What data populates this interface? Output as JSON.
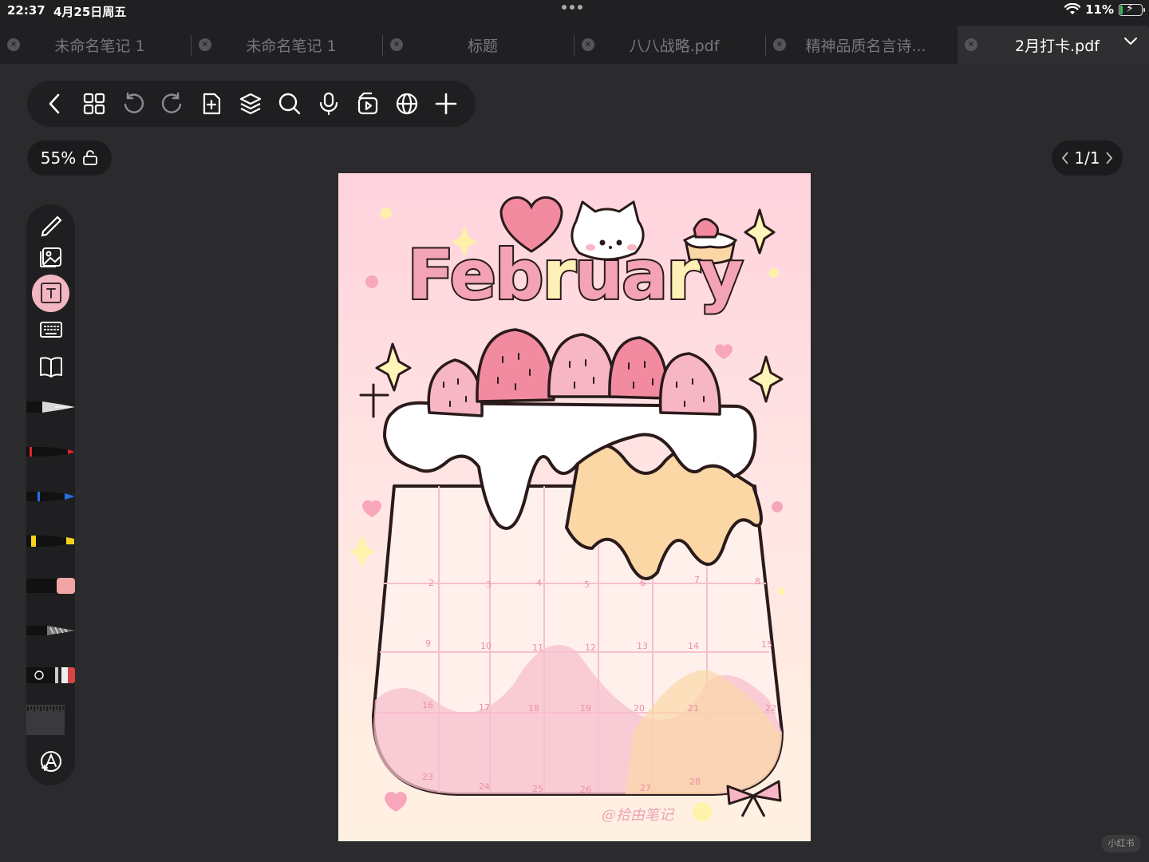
{
  "status": {
    "time": "22:37",
    "date": "4月25日周五",
    "battery_text": "11%",
    "battery_level": 0.11
  },
  "tabs": [
    {
      "label": "未命名笔记 1",
      "active": false
    },
    {
      "label": "未命名笔记 1",
      "active": false
    },
    {
      "label": "标题",
      "active": false
    },
    {
      "label": "八八战略.pdf",
      "active": false
    },
    {
      "label": "精神品质名言诗...",
      "active": false
    },
    {
      "label": "2月打卡.pdf",
      "active": true
    }
  ],
  "toolbar": {
    "icons": [
      "back-chevron-icon",
      "grid-icon",
      "undo-icon",
      "redo-icon",
      "add-page-icon",
      "layers-icon",
      "search-icon",
      "microphone-icon",
      "media-icon",
      "globe-icon",
      "plus-icon"
    ]
  },
  "zoom": {
    "label": "55%"
  },
  "pager": {
    "label": "1/1"
  },
  "sidebar": {
    "tools": [
      "pencil-icon",
      "image-icon",
      "text-box-icon",
      "keyboard-icon",
      "book-icon"
    ],
    "active_tool": "text-box-icon",
    "pens": [
      {
        "name": "fountain-pen",
        "color": "#d8d8d8"
      },
      {
        "name": "red-marker",
        "color": "#e0242e"
      },
      {
        "name": "blue-marker",
        "color": "#2370e0"
      },
      {
        "name": "yellow-highlighter",
        "color": "#f6d21c"
      },
      {
        "name": "pink-eraser",
        "color": "#f2a5a5"
      },
      {
        "name": "pattern-brush",
        "color": "#bbbbbb"
      },
      {
        "name": "lasso-tool",
        "color": "#e04848"
      },
      {
        "name": "ruler-tool",
        "color": "#3a3a3c"
      }
    ]
  },
  "page": {
    "title_parts": [
      "Feb",
      "r",
      "ua",
      "r",
      "y"
    ],
    "calendar_numbers": [
      "2",
      "3",
      "4",
      "5",
      "6",
      "7",
      "8",
      "9",
      "10",
      "11",
      "12",
      "13",
      "14",
      "15",
      "16",
      "17",
      "18",
      "19",
      "20",
      "21",
      "22",
      "23",
      "24",
      "25",
      "26",
      "27",
      "28"
    ],
    "watermark": "@拾由笔记"
  },
  "brand_badge": "小红书",
  "colors": {
    "accent_pink": "#f3b6c3",
    "background": "#2b2b2d",
    "panel": "#1f1f21"
  }
}
